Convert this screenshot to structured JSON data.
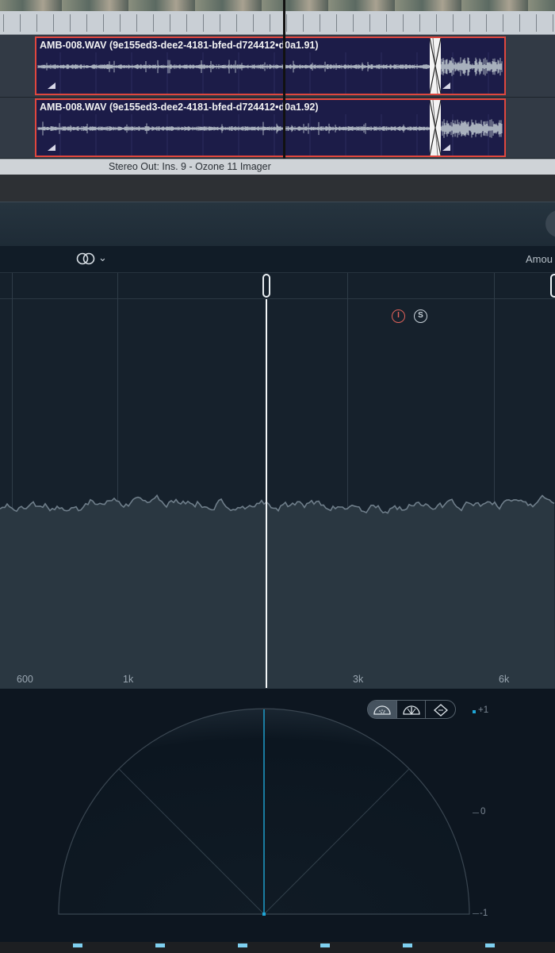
{
  "tracks": [
    {
      "region_name": "AMB-008.WAV (9e155ed3-dee2-4181-bfed-d724412•d0a1.91)"
    },
    {
      "region_name": "AMB-008.WAV (9e155ed3-dee2-4181-bfed-d724412•d0a1.92)"
    }
  ],
  "status_bar": {
    "text": "Stereo Out: Ins. 9 - Ozone 11 Imager"
  },
  "plugin": {
    "control_bar": {
      "amount_label": "Amou",
      "stereo_icon": "stereo-link-icon"
    },
    "band_solo": {
      "mute_label": "I",
      "solo_label": "S"
    },
    "freq_labels": [
      "600",
      "1k",
      "3k",
      "6k"
    ],
    "vectorscope": {
      "modes": [
        "polar-sample-icon",
        "polar-level-icon",
        "lissajous-icon"
      ],
      "active_mode": 0,
      "scale": {
        "top": "+1",
        "mid": "0",
        "bottom": "-1"
      },
      "accent_color": "#1fa6d6"
    }
  },
  "colors": {
    "region_border": "#e0473e",
    "region_fill": "#1c1c48",
    "waveform": "#b9c2cb",
    "spectrum_fill": "#2a3741"
  }
}
